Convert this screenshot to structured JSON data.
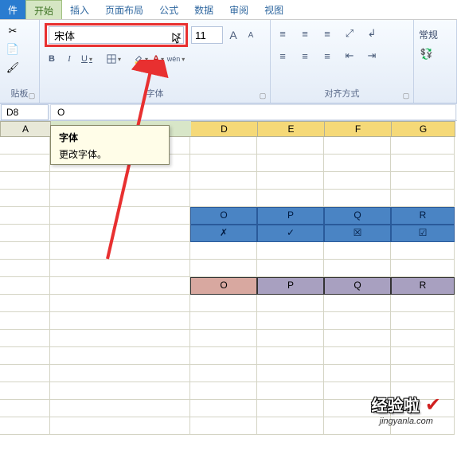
{
  "tabs": {
    "file": "件",
    "home": "开始",
    "insert": "插入",
    "layout": "页面布局",
    "formulas": "公式",
    "data": "数据",
    "review": "审阅",
    "view": "视图"
  },
  "ribbon": {
    "clipboard_label": "贴板",
    "font_label": "字体",
    "align_label": "对齐方式",
    "font_name": "宋体",
    "font_size": "11",
    "bold": "B",
    "italic": "I",
    "underline": "U",
    "grow_font": "A",
    "shrink_font": "A",
    "font_color_a": "A",
    "wen": "wén",
    "general": "常规"
  },
  "tooltip": {
    "title": "字体",
    "body": "更改字体。"
  },
  "namebox": "D8",
  "formula_bar": "O",
  "col_headers": [
    "A",
    "D",
    "E",
    "F",
    "G"
  ],
  "table_blue": {
    "row1": [
      "O",
      "P",
      "Q",
      "R"
    ],
    "row2": [
      "✗",
      "✓",
      "☒",
      "☑"
    ]
  },
  "table_sel": [
    "O",
    "P",
    "Q",
    "R"
  ],
  "watermark": {
    "main": "经验啦",
    "sub": "jingyanla.com"
  }
}
